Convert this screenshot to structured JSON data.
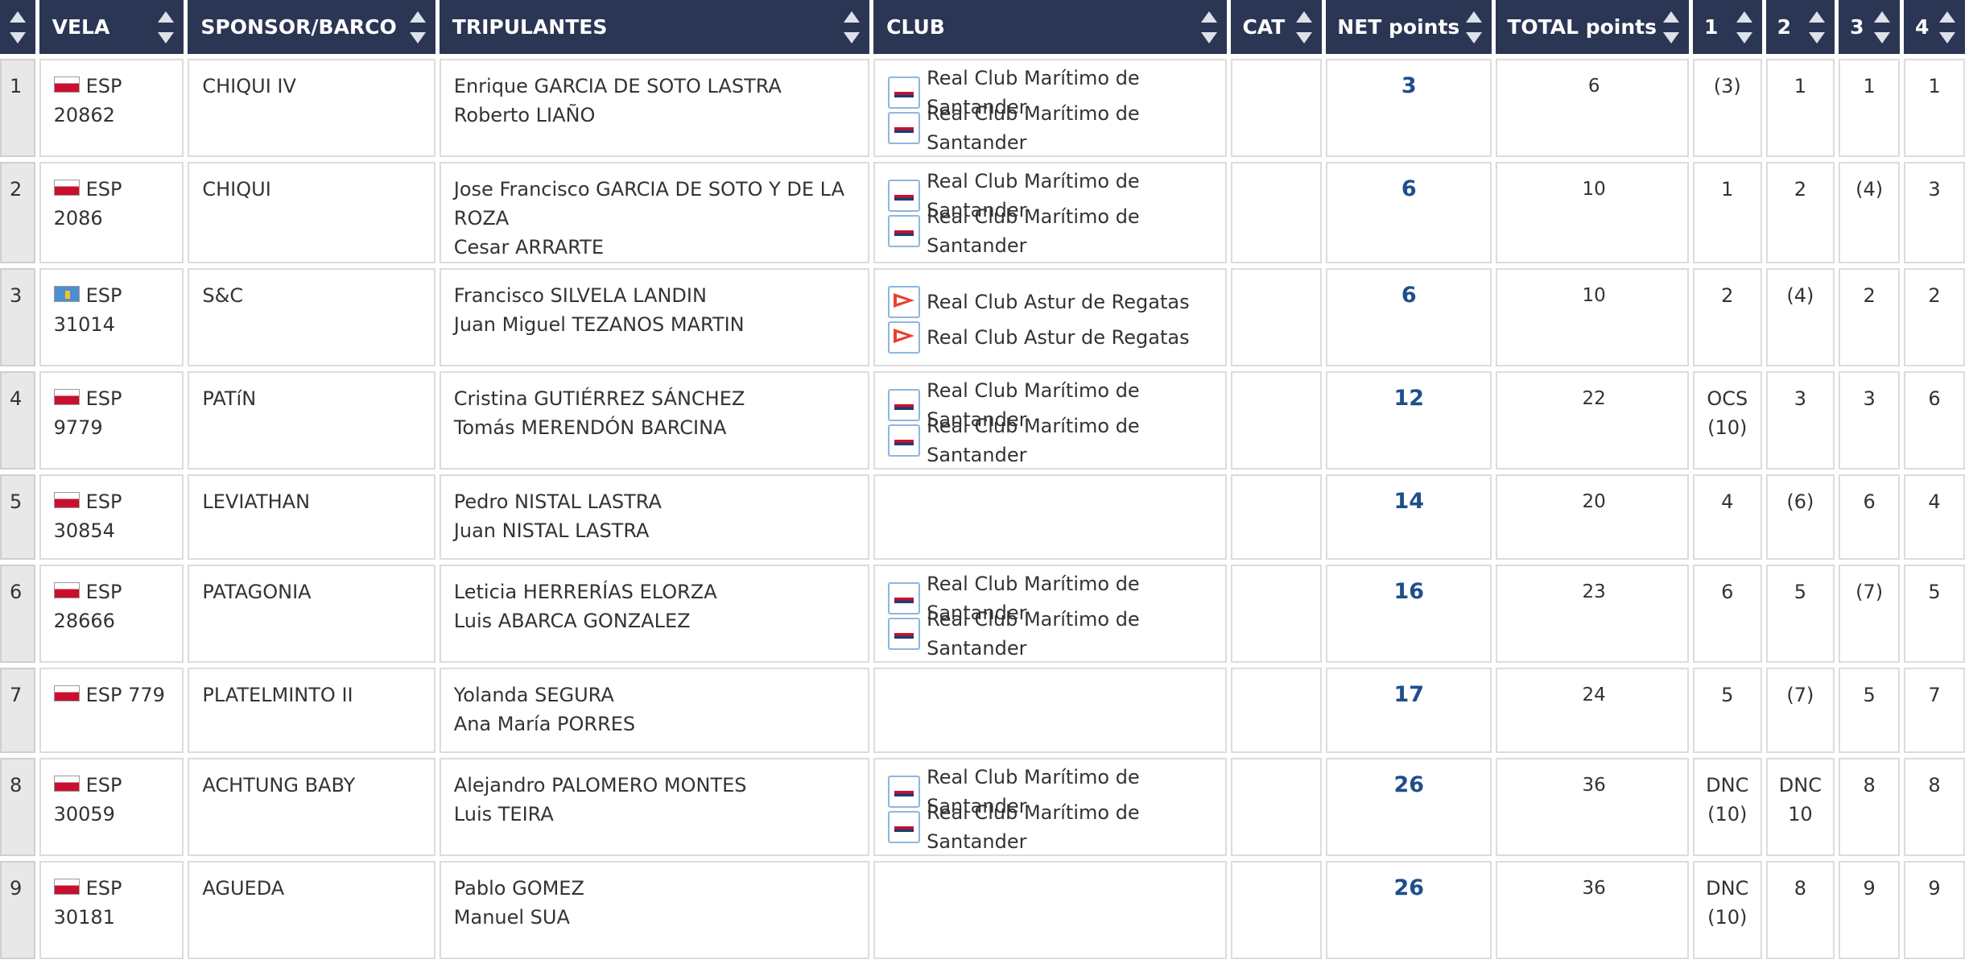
{
  "columns": {
    "vela": "VELA",
    "sponsor": "SPONSOR/BARCO",
    "crew": "TRIPULANTES",
    "club": "CLUB",
    "cat": "CAT",
    "net": "NET points",
    "total": "TOTAL points",
    "r1": "1",
    "r2": "2",
    "r3": "3",
    "r4": "4"
  },
  "colors": {
    "header_bg": "#2b3654",
    "net_text": "#1f4e8c",
    "position_bg": "#e8e8e8"
  },
  "rows": [
    {
      "pos": "1",
      "flag": "red",
      "sail": "ESP 20862",
      "sponsor": "CHIQUI IV",
      "crew": [
        "Enrique GARCIA DE SOTO LASTRA",
        "Roberto LIAÑO"
      ],
      "club_icon": "rcms",
      "clubs": [
        "Real Club Marítimo de Santander",
        "Real Club Marítimo de Santander"
      ],
      "cat": "",
      "net": "3",
      "total": "6",
      "r": [
        [
          "(3)"
        ],
        [
          "1"
        ],
        [
          "1"
        ],
        [
          "1"
        ]
      ]
    },
    {
      "pos": "2",
      "flag": "red",
      "sail": "ESP 2086",
      "sponsor": "CHIQUI",
      "crew": [
        "Jose Francisco GARCIA DE SOTO Y DE LA ROZA",
        "Cesar ARRARTE"
      ],
      "club_icon": "rcms",
      "clubs": [
        "Real Club Marítimo de Santander",
        "Real Club Marítimo de Santander"
      ],
      "cat": "",
      "net": "6",
      "total": "10",
      "r": [
        [
          "1"
        ],
        [
          "2"
        ],
        [
          "(4)"
        ],
        [
          "3"
        ]
      ]
    },
    {
      "pos": "3",
      "flag": "blue",
      "sail": "ESP 31014",
      "sponsor": "S&C",
      "crew": [
        "Francisco SILVELA LANDIN",
        "Juan Miguel TEZANOS MARTIN"
      ],
      "club_icon": "rcar",
      "clubs": [
        "Real Club Astur de Regatas",
        "Real Club Astur de Regatas"
      ],
      "cat": "",
      "net": "6",
      "total": "10",
      "r": [
        [
          "2"
        ],
        [
          "(4)"
        ],
        [
          "2"
        ],
        [
          "2"
        ]
      ]
    },
    {
      "pos": "4",
      "flag": "red",
      "sail": "ESP 9779",
      "sponsor": "PATíN",
      "crew": [
        "Cristina GUTIÉRREZ SÁNCHEZ",
        "Tomás MERENDÓN BARCINA"
      ],
      "club_icon": "rcms",
      "clubs": [
        "Real Club Marítimo de Santander",
        "Real Club Marítimo de Santander"
      ],
      "cat": "",
      "net": "12",
      "total": "22",
      "r": [
        [
          "OCS",
          "(10)"
        ],
        [
          "3"
        ],
        [
          "3"
        ],
        [
          "6"
        ]
      ]
    },
    {
      "pos": "5",
      "flag": "red",
      "sail": "ESP 30854",
      "sponsor": "LEVIATHAN",
      "crew": [
        "Pedro NISTAL LASTRA",
        "Juan NISTAL LASTRA"
      ],
      "club_icon": "",
      "clubs": [],
      "cat": "",
      "net": "14",
      "total": "20",
      "r": [
        [
          "4"
        ],
        [
          "(6)"
        ],
        [
          "6"
        ],
        [
          "4"
        ]
      ]
    },
    {
      "pos": "6",
      "flag": "red",
      "sail": "ESP 28666",
      "sponsor": "PATAGONIA",
      "crew": [
        "Leticia HERRERÍAS ELORZA",
        "Luis ABARCA GONZALEZ"
      ],
      "club_icon": "rcms",
      "clubs": [
        "Real Club Marítimo de Santander",
        "Real Club Marítimo de Santander"
      ],
      "cat": "",
      "net": "16",
      "total": "23",
      "r": [
        [
          "6"
        ],
        [
          "5"
        ],
        [
          "(7)"
        ],
        [
          "5"
        ]
      ]
    },
    {
      "pos": "7",
      "flag": "red",
      "sail": "ESP 779",
      "sponsor": "PLATELMINTO II",
      "crew": [
        "Yolanda SEGURA",
        "Ana María PORRES"
      ],
      "club_icon": "",
      "clubs": [],
      "cat": "",
      "net": "17",
      "total": "24",
      "r": [
        [
          "5"
        ],
        [
          "(7)"
        ],
        [
          "5"
        ],
        [
          "7"
        ]
      ]
    },
    {
      "pos": "8",
      "flag": "red",
      "sail": "ESP 30059",
      "sponsor": "ACHTUNG BABY",
      "crew": [
        "Alejandro PALOMERO MONTES",
        "Luis TEIRA"
      ],
      "club_icon": "rcms",
      "clubs": [
        "Real Club Marítimo de Santander",
        "Real Club Marítimo de Santander"
      ],
      "cat": "",
      "net": "26",
      "total": "36",
      "r": [
        [
          "DNC",
          "(10)"
        ],
        [
          "DNC",
          "10"
        ],
        [
          "8"
        ],
        [
          "8"
        ]
      ]
    },
    {
      "pos": "9",
      "flag": "red",
      "sail": "ESP 30181",
      "sponsor": "AGUEDA",
      "crew": [
        "Pablo GOMEZ",
        "Manuel SUA"
      ],
      "club_icon": "",
      "clubs": [],
      "cat": "",
      "net": "26",
      "total": "36",
      "r": [
        [
          "DNC",
          "(10)"
        ],
        [
          "8"
        ],
        [
          "9"
        ],
        [
          "9"
        ]
      ]
    }
  ]
}
